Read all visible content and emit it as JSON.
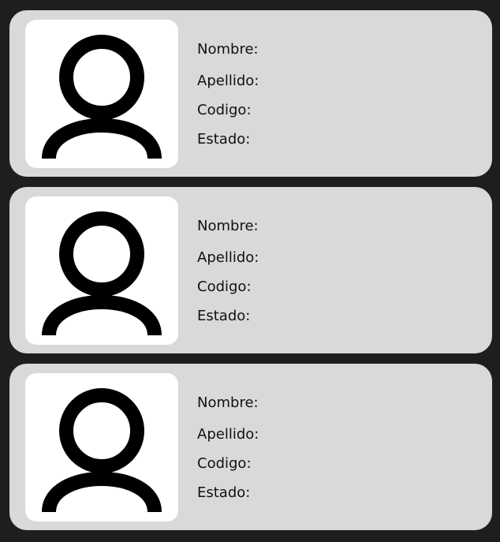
{
  "students": [
    {
      "nombre_label": "Nombre:",
      "apellido_label": "Apellido:",
      "codigo_label": "Codigo:",
      "estado_label": "Estado:",
      "avatar_icon": "user-icon"
    },
    {
      "nombre_label": "Nombre:",
      "apellido_label": "Apellido:",
      "codigo_label": "Codigo:",
      "estado_label": "Estado:",
      "avatar_icon": "user-icon"
    },
    {
      "nombre_label": "Nombre:",
      "apellido_label": "Apellido:",
      "codigo_label": "Codigo:",
      "estado_label": "Estado:",
      "avatar_icon": "user-icon"
    }
  ],
  "colors": {
    "background": "#1e1e1e",
    "card": "#d9d9d9",
    "avatar_background": "#ffffff",
    "icon": "#000000",
    "text": "#111111"
  }
}
